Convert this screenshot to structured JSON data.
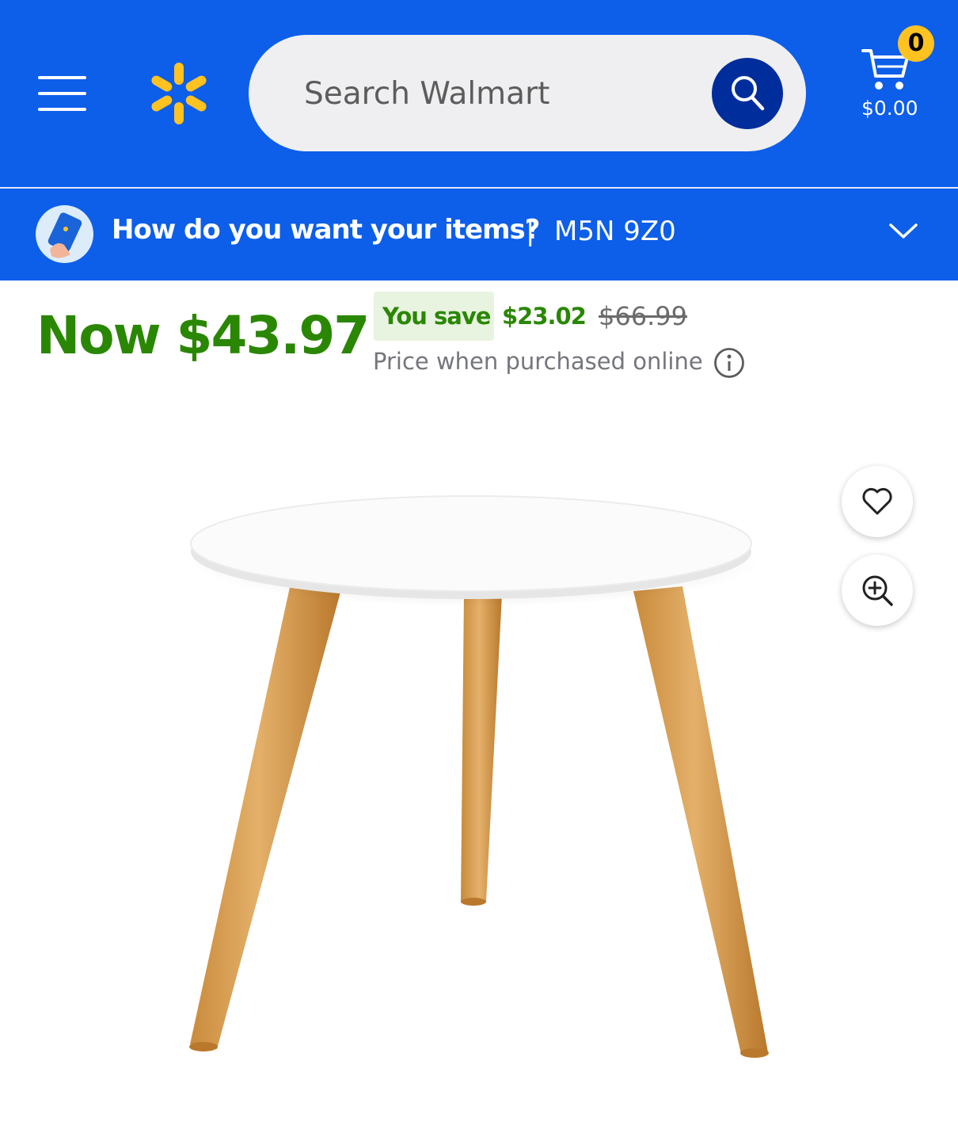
{
  "header": {
    "search_placeholder": "Search Walmart",
    "cart_count": "0",
    "cart_total": "$0.00"
  },
  "delivery": {
    "question": "How do you want your items?",
    "separator": "|",
    "postal_code": "M5N 9Z0"
  },
  "price": {
    "current": "Now $43.97",
    "you_save_label": "You save",
    "savings": "$23.02",
    "was": "$66.99",
    "note": "Price when purchased online"
  },
  "colors": {
    "brand_blue": "#0d5ee9",
    "spark_yellow": "#ffc220",
    "price_green": "#2a8703"
  },
  "icons": [
    "menu-icon",
    "walmart-spark-icon",
    "search-icon",
    "cart-icon",
    "chevron-down-icon",
    "info-icon",
    "heart-icon",
    "zoom-in-icon"
  ]
}
